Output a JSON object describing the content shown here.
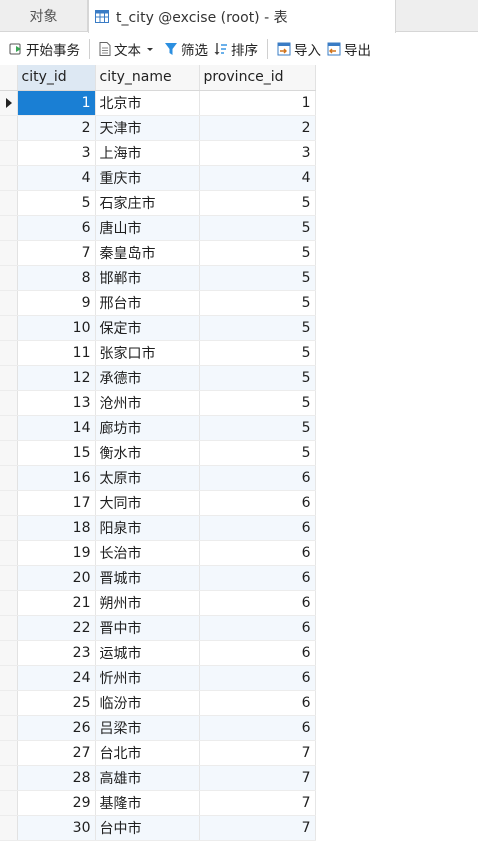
{
  "tabs": {
    "objects_label": "对象",
    "active_label": "t_city @excise (root) - 表"
  },
  "toolbar": {
    "begin_transaction": "开始事务",
    "text": "文本",
    "filter": "筛选",
    "sort": "排序",
    "import": "导入",
    "export": "导出"
  },
  "grid": {
    "columns": [
      "city_id",
      "city_name",
      "province_id"
    ],
    "rows": [
      [
        "1",
        "北京市",
        "1"
      ],
      [
        "2",
        "天津市",
        "2"
      ],
      [
        "3",
        "上海市",
        "3"
      ],
      [
        "4",
        "重庆市",
        "4"
      ],
      [
        "5",
        "石家庄市",
        "5"
      ],
      [
        "6",
        "唐山市",
        "5"
      ],
      [
        "7",
        "秦皇岛市",
        "5"
      ],
      [
        "8",
        "邯郸市",
        "5"
      ],
      [
        "9",
        "邢台市",
        "5"
      ],
      [
        "10",
        "保定市",
        "5"
      ],
      [
        "11",
        "张家口市",
        "5"
      ],
      [
        "12",
        "承德市",
        "5"
      ],
      [
        "13",
        "沧州市",
        "5"
      ],
      [
        "14",
        "廊坊市",
        "5"
      ],
      [
        "15",
        "衡水市",
        "5"
      ],
      [
        "16",
        "太原市",
        "6"
      ],
      [
        "17",
        "大同市",
        "6"
      ],
      [
        "18",
        "阳泉市",
        "6"
      ],
      [
        "19",
        "长治市",
        "6"
      ],
      [
        "20",
        "晋城市",
        "6"
      ],
      [
        "21",
        "朔州市",
        "6"
      ],
      [
        "22",
        "晋中市",
        "6"
      ],
      [
        "23",
        "运城市",
        "6"
      ],
      [
        "24",
        "忻州市",
        "6"
      ],
      [
        "25",
        "临汾市",
        "6"
      ],
      [
        "26",
        "吕梁市",
        "6"
      ],
      [
        "27",
        "台北市",
        "7"
      ],
      [
        "28",
        "高雄市",
        "7"
      ],
      [
        "29",
        "基隆市",
        "7"
      ],
      [
        "30",
        "台中市",
        "7"
      ]
    ]
  },
  "colors": {
    "accent": "#1a7fd4",
    "alt_row": "#f3f8fd"
  }
}
